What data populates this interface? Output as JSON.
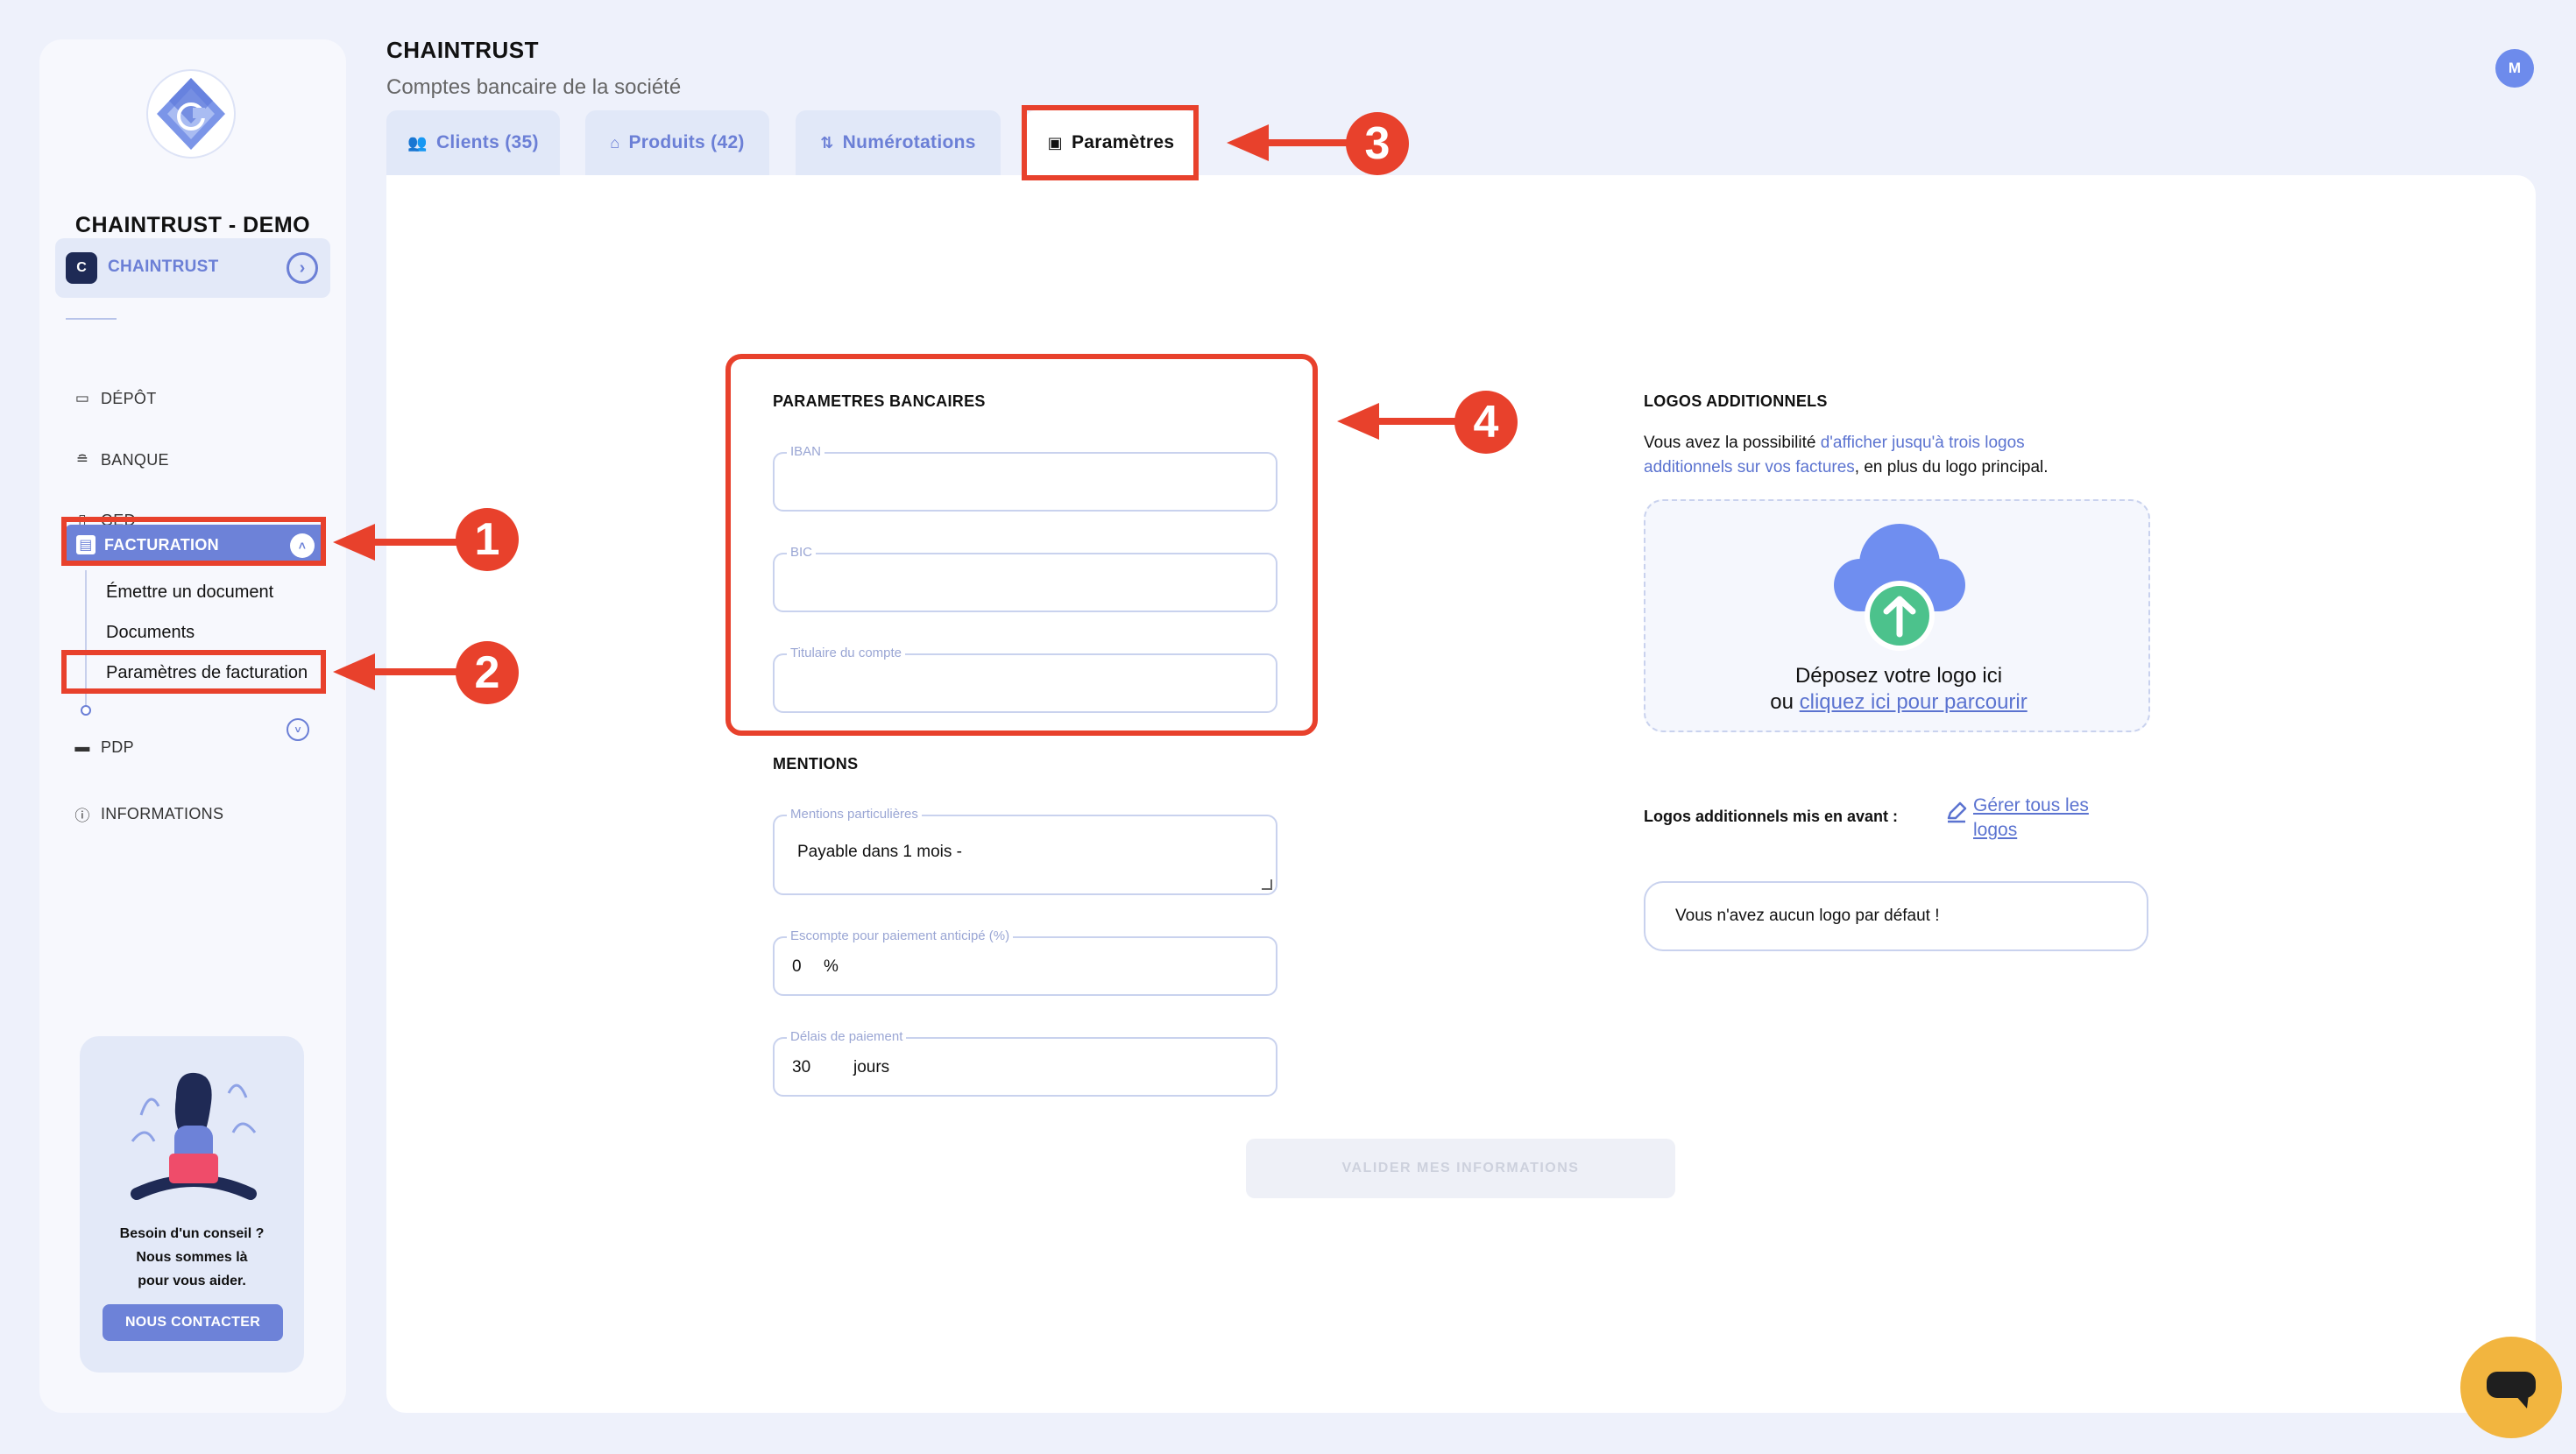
{
  "sidebar": {
    "company_name": "CHAINTRUST - DEMO",
    "switch": {
      "label": "CHAINTRUST",
      "logo_letter": "C"
    },
    "nav": [
      {
        "label": "DÉPÔT",
        "icon": "folder-icon"
      },
      {
        "label": "BANQUE",
        "icon": "bank-icon"
      },
      {
        "label": "GED",
        "icon": "document-icon"
      }
    ],
    "active": {
      "label": "FACTURATION",
      "icon": "invoice-icon"
    },
    "sub_items": [
      "Émettre un document",
      "Documents",
      "Paramètres de facturation"
    ],
    "pdp": {
      "label": "PDP",
      "icon": "card-icon"
    },
    "informations": {
      "label": "INFORMATIONS",
      "icon": "info-icon"
    },
    "help": {
      "line1": "Besoin d'un conseil ?",
      "line2": "Nous sommes là",
      "line3": "pour vous aider.",
      "button": "NOUS CONTACTER"
    }
  },
  "header": {
    "title": "CHAINTRUST",
    "subtitle": "Comptes bancaire de la société",
    "avatar": "M"
  },
  "tabs": [
    {
      "label": "Clients (35)",
      "icon": "users-icon"
    },
    {
      "label": "Produits (42)",
      "icon": "box-icon"
    },
    {
      "label": "Numérotations",
      "icon": "sort-icon"
    },
    {
      "label": "Paramètres",
      "icon": "wallet-icon",
      "active": true
    }
  ],
  "bank": {
    "title": "PARAMETRES BANCAIRES",
    "iban": {
      "label": "IBAN",
      "value": ""
    },
    "bic": {
      "label": "BIC",
      "value": ""
    },
    "holder": {
      "label": "Titulaire du compte",
      "value": ""
    }
  },
  "mentions": {
    "title": "MENTIONS",
    "particular": {
      "label": "Mentions particulières",
      "value": "Payable dans 1 mois -"
    },
    "discount": {
      "label": "Escompte pour paiement anticipé (%)",
      "value": "0",
      "unit": "%"
    },
    "delay": {
      "label": "Délais de paiement",
      "value": "30",
      "unit": "jours"
    }
  },
  "submit_label": "VALIDER MES INFORMATIONS",
  "logos": {
    "title": "LOGOS ADDITIONNELS",
    "desc_pre": "Vous avez la possibilité ",
    "desc_hl": "d'afficher jusqu'à trois logos additionnels sur vos factures",
    "desc_post": ", en plus du logo principal.",
    "drop_line1": "Déposez votre logo ici",
    "drop_or": "ou ",
    "drop_link": "cliquez ici pour parcourir",
    "featured_label": "Logos additionnels mis en avant :",
    "manage_link": "Gérer tous les logos",
    "empty_text": "Vous n'avez aucun logo par défaut !"
  },
  "annotations": [
    "1",
    "2",
    "3",
    "4"
  ],
  "colors": {
    "accent": "#6d82d8",
    "annotation": "#e8412c",
    "chat": "#f2b53f"
  }
}
